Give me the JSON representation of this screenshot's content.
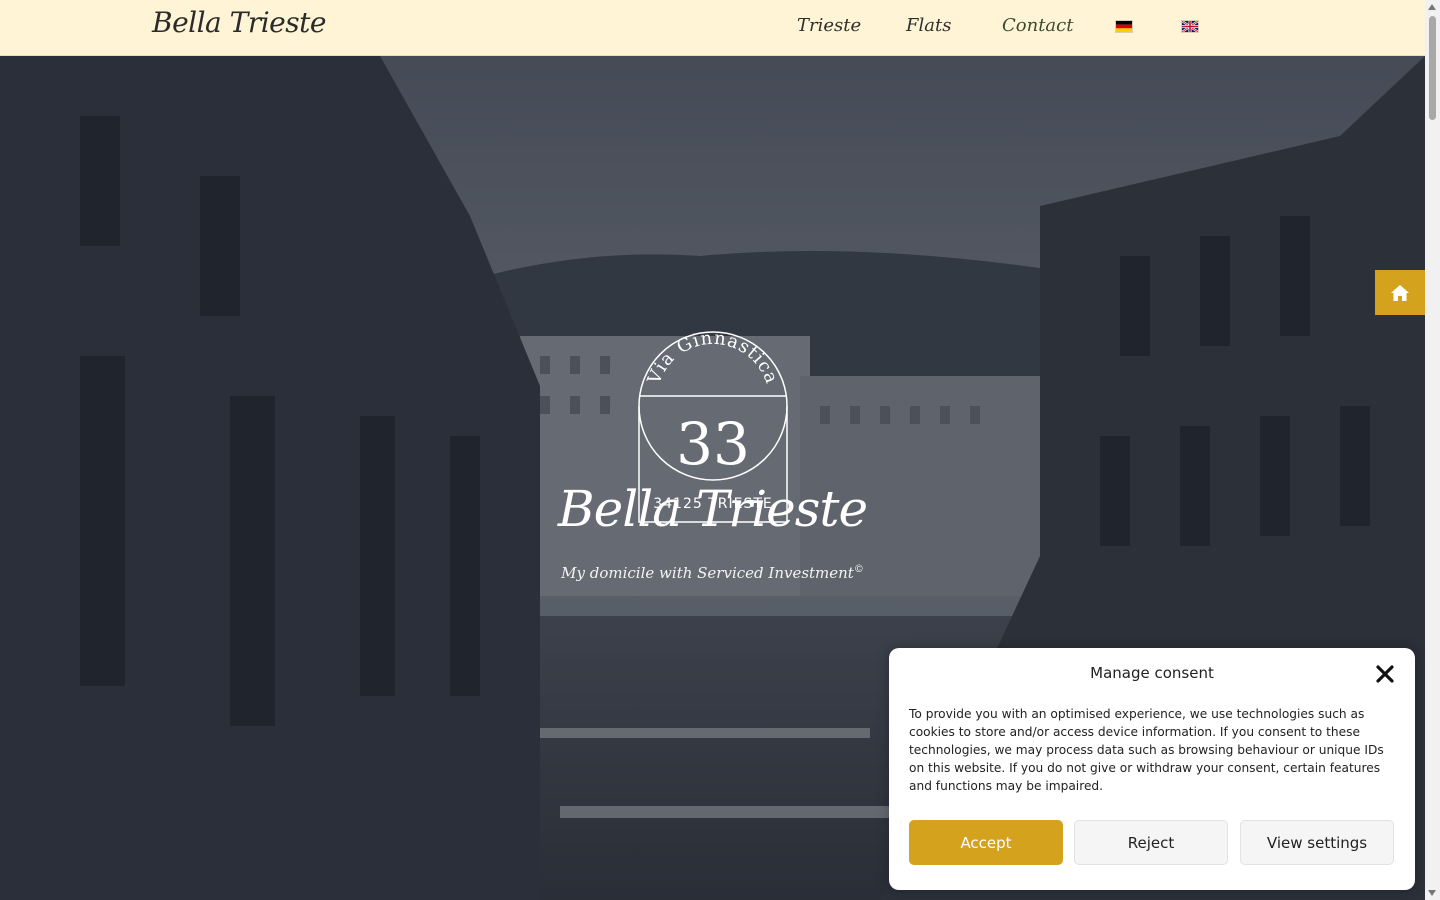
{
  "header": {
    "brand": "Bella Trieste",
    "nav": [
      "Trieste",
      "Flats",
      "Contact"
    ],
    "languages": [
      {
        "name": "german-flag-icon"
      },
      {
        "name": "english-flag-icon"
      }
    ]
  },
  "hero": {
    "seal": {
      "arc_text": "Via Ginnastica",
      "number": "33",
      "city": "34125 TRIESTE"
    },
    "title": "Bella Trieste",
    "subtitle": "My domicile with Serviced Investment",
    "subtitle_mark": "©",
    "home_button_icon": "home-icon"
  },
  "consent": {
    "title": "Manage consent",
    "text": "To provide you with an optimised experience, we use technologies such as cookies to store and/or access device information. If you consent to these technologies, we may process data such as browsing behaviour or unique IDs on this website. If you do not give or withdraw your consent, certain features and functions may be impaired.",
    "accept": "Accept",
    "reject": "Reject",
    "settings": "View settings"
  },
  "colors": {
    "header_bg": "#fff4d6",
    "accent": "#d5a21d"
  }
}
